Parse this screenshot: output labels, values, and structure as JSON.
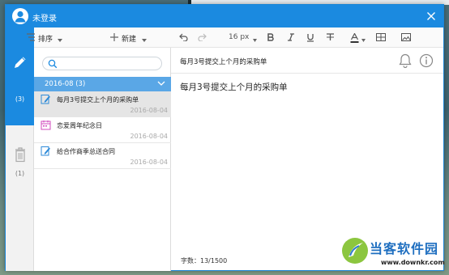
{
  "window": {
    "title": "未登录"
  },
  "rail": {
    "notes_count": "(3)",
    "trash_count": "(1)"
  },
  "list": {
    "sort_label": "排序",
    "new_label": "新建",
    "search_placeholder": "",
    "group_label": "2016-08 (3)",
    "notes": [
      {
        "title": "每月3号提交上个月的采购单",
        "date": "2016-08-04",
        "selected": true,
        "icon": "note-icon"
      },
      {
        "title": "恋爱周年纪念日",
        "date": "2016-08-04",
        "selected": false,
        "icon": "calendar-icon"
      },
      {
        "title": "给合作商季总送合同",
        "date": "2016-08-04",
        "selected": false,
        "icon": "note-icon"
      }
    ]
  },
  "toolbar": {
    "font_size": "16 px"
  },
  "editor": {
    "header_title": "每月3号提交上个月的采购单",
    "body": "每月3号提交上个月的采购单",
    "word_count": "字数：13/1500"
  },
  "watermark": {
    "cn": "当客软件园",
    "url": "www.downkr.com"
  },
  "colors": {
    "accent": "#1b8ae0",
    "group_bar": "#5aa7e6",
    "selected_row": "#e5e5e5"
  }
}
